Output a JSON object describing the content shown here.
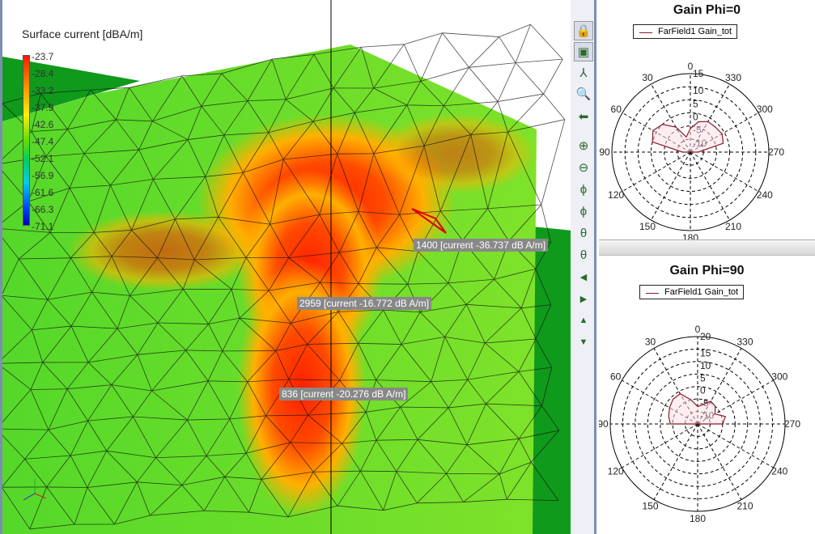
{
  "viewport": {
    "legend_title": "Surface current [dBA/m]",
    "colorbar_ticks": [
      "-23.7",
      "-28.4",
      "-33.2",
      "-37.9",
      "-42.6",
      "-47.4",
      "-52.1",
      "-56.9",
      "-61.6",
      "-66.3",
      "-71.1"
    ],
    "annotations": [
      {
        "id": "1400",
        "text": "1400 [current -36.737 dB A/m]"
      },
      {
        "id": "2959",
        "text": "2959 [current -16.772 dB A/m]"
      },
      {
        "id": "836",
        "text": "836 [current -20.276 dB A/m]"
      }
    ]
  },
  "toolbar": [
    "lock-z-icon",
    "fit-view-icon",
    "axes-r-icon",
    "zoom-box-icon",
    "back-arrow-icon",
    "zoom-in-icon",
    "zoom-out-icon",
    "rotate-phi-left-icon",
    "rotate-phi-right-icon",
    "rotate-theta-down-icon",
    "rotate-theta-up-icon",
    "pan-left-icon",
    "pan-right-icon",
    "pan-up-icon",
    "pan-down-icon"
  ],
  "colors": {
    "trace": "#8b1a2a",
    "mesh_green": "#5fdc2a",
    "dark_green": "#0f9a1c",
    "hot": "#ff2a00"
  },
  "chart_data": [
    {
      "type": "polar",
      "title": "Gain Phi=0",
      "legend": [
        "FarField1 Gain_tot"
      ],
      "angle_labels": [
        "0",
        "30",
        "60",
        "90",
        "120",
        "150",
        "180",
        "210",
        "240",
        "270",
        "300",
        "330"
      ],
      "radial_ticks": [
        "15",
        "10",
        "5",
        "0",
        "-5",
        "-10"
      ],
      "rlim": [
        -15,
        15
      ],
      "series": [
        {
          "name": "FarField1 Gain_tot",
          "theta": [
            0,
            15,
            30,
            45,
            60,
            75,
            90,
            105,
            180,
            255,
            270,
            285,
            300,
            315,
            330,
            345,
            360
          ],
          "gain": [
            -6,
            -9,
            -4,
            0,
            1.5,
            0,
            -12,
            -15,
            -15,
            -15,
            -12,
            -2,
            -1,
            -1.5,
            -1.5,
            -3,
            -6
          ]
        }
      ]
    },
    {
      "type": "polar",
      "title": "Gain Phi=90",
      "legend": [
        "FarField1 Gain_tot"
      ],
      "angle_labels": [
        "0",
        "30",
        "60",
        "90",
        "120",
        "150",
        "180",
        "210",
        "240",
        "270",
        "300",
        "330"
      ],
      "radial_ticks": [
        "20",
        "15",
        "10",
        "5",
        "0",
        "-5",
        "-10"
      ],
      "rlim": [
        -15,
        20
      ],
      "series": [
        {
          "name": "FarField1 Gain_tot",
          "theta": [
            0,
            15,
            30,
            45,
            60,
            75,
            90,
            105,
            180,
            255,
            270,
            285,
            300,
            315,
            330,
            345,
            360
          ],
          "gain": [
            -8,
            -5,
            -1,
            -1,
            -2,
            -3,
            -4,
            -15,
            -15,
            -15,
            -5,
            -3.5,
            -7,
            -5,
            -4.5,
            -7,
            -8
          ]
        }
      ]
    }
  ]
}
